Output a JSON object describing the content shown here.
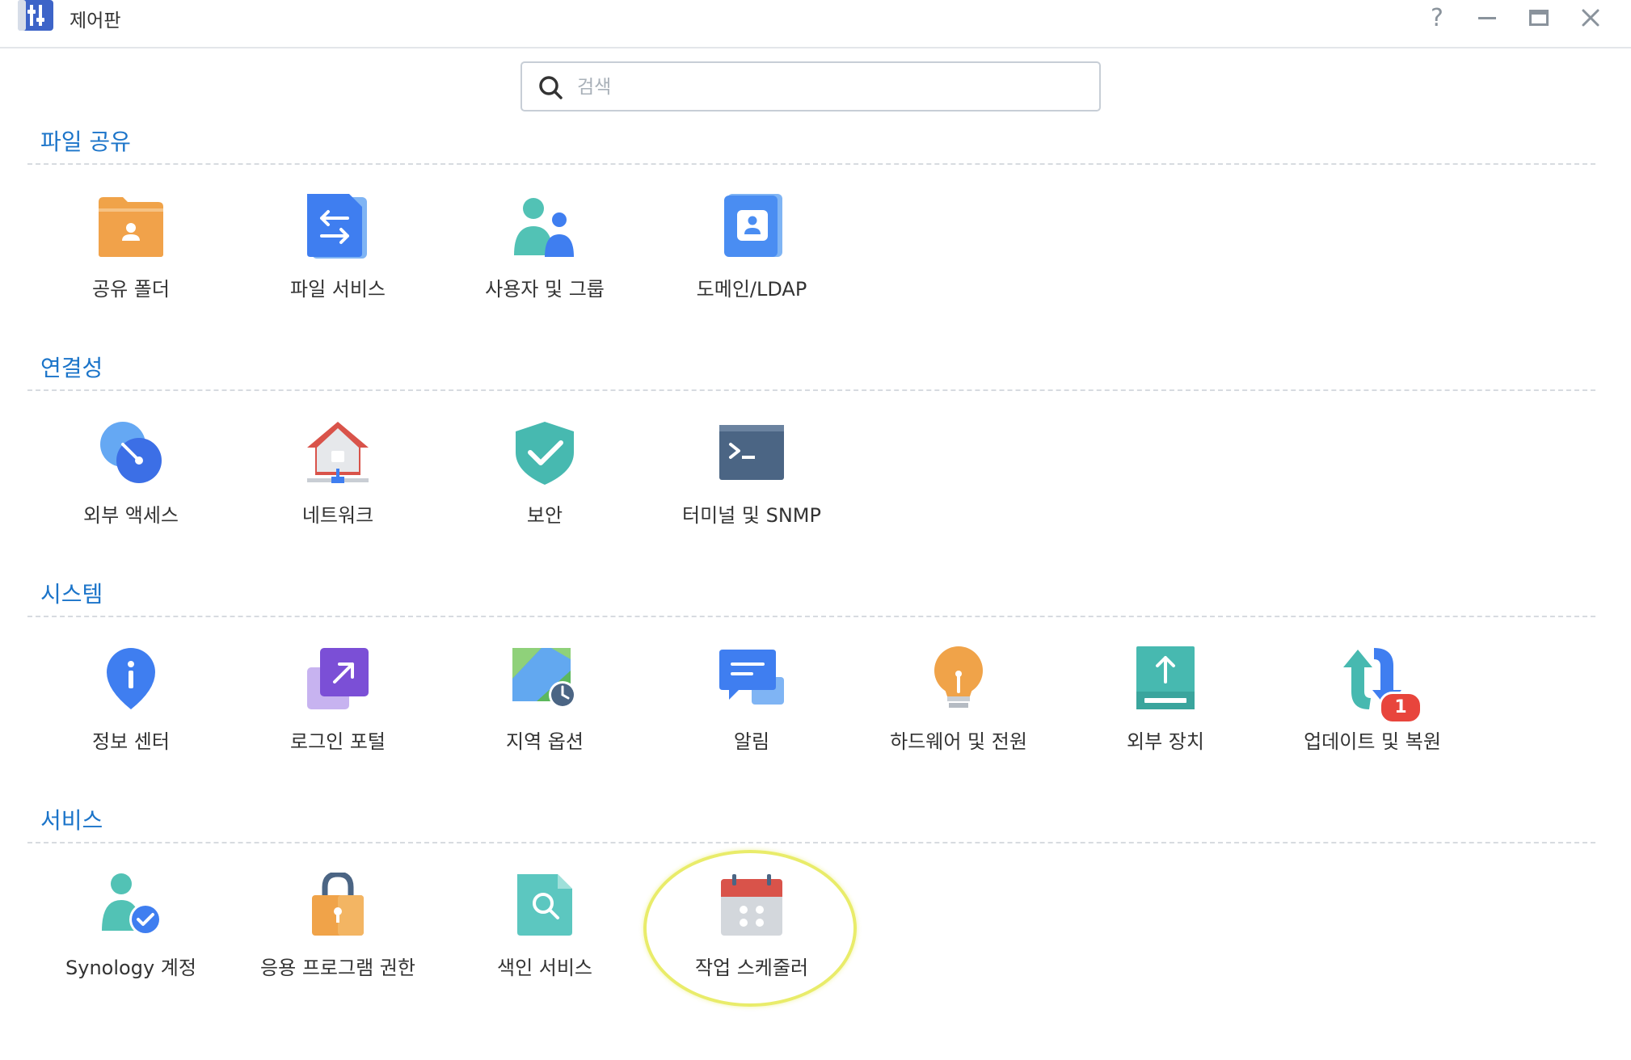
{
  "window": {
    "title": "제어판",
    "help": "?",
    "minimize": "minimize",
    "maximize": "maximize",
    "close": "close"
  },
  "search": {
    "placeholder": "검색",
    "value": ""
  },
  "sections": [
    {
      "title": "파일 공유",
      "items": [
        {
          "label": "공유 폴더",
          "icon": "shared-folder-icon"
        },
        {
          "label": "파일 서비스",
          "icon": "file-services-icon"
        },
        {
          "label": "사용자 및 그룹",
          "icon": "user-group-icon"
        },
        {
          "label": "도메인/LDAP",
          "icon": "domain-ldap-icon"
        }
      ]
    },
    {
      "title": "연결성",
      "items": [
        {
          "label": "외부 액세스",
          "icon": "external-access-icon"
        },
        {
          "label": "네트워크",
          "icon": "network-icon"
        },
        {
          "label": "보안",
          "icon": "security-shield-icon"
        },
        {
          "label": "터미널 및 SNMP",
          "icon": "terminal-icon"
        }
      ]
    },
    {
      "title": "시스템",
      "items": [
        {
          "label": "정보 센터",
          "icon": "info-center-icon"
        },
        {
          "label": "로그인 포털",
          "icon": "login-portal-icon"
        },
        {
          "label": "지역 옵션",
          "icon": "regional-options-icon"
        },
        {
          "label": "알림",
          "icon": "notification-icon"
        },
        {
          "label": "하드웨어 및 전원",
          "icon": "hardware-power-icon"
        },
        {
          "label": "외부 장치",
          "icon": "external-devices-icon"
        },
        {
          "label": "업데이트 및 복원",
          "icon": "update-restore-icon",
          "badge": "1"
        }
      ]
    },
    {
      "title": "서비스",
      "items": [
        {
          "label": "Synology 계정",
          "icon": "synology-account-icon"
        },
        {
          "label": "응용 프로그램 권한",
          "icon": "application-privileges-icon"
        },
        {
          "label": "색인 서비스",
          "icon": "indexing-service-icon"
        },
        {
          "label": "작업 스케줄러",
          "icon": "task-scheduler-icon",
          "highlighted": true
        }
      ]
    }
  ],
  "colors": {
    "section_title": "#1b74c9",
    "badge": "#e8453c",
    "highlight_ring": "#e9ec6a"
  }
}
